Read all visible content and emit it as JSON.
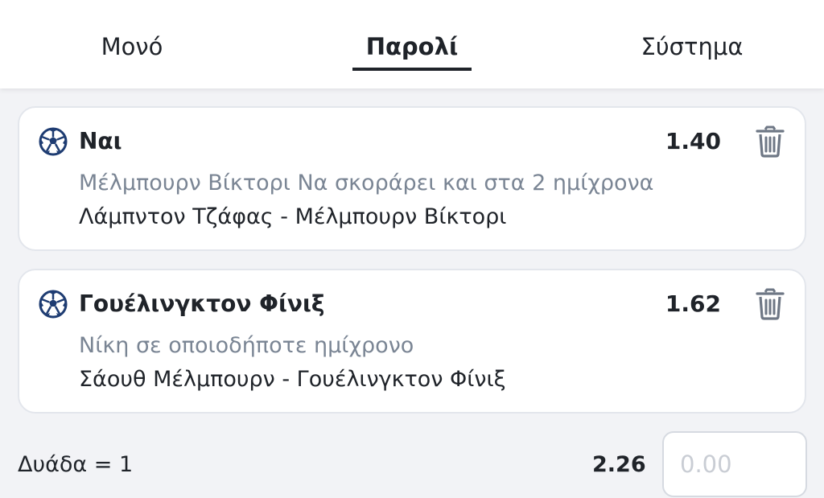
{
  "tabs": {
    "single": "Μονό",
    "parlay": "Παρολί",
    "system": "Σύστημα",
    "active": "parlay"
  },
  "selections": [
    {
      "title": "Ναι",
      "odds": "1.40",
      "market": "Μέλμπουρν Βίκτορι Να σκοράρει και στα 2 ημίχρονα",
      "event": "Λάμπντον Τζάφας - Μέλμπουρν Βίκτορι",
      "sport_icon": "soccer-ball-icon",
      "delete_icon": "trash-icon"
    },
    {
      "title": "Γουέλινγκτον Φίνιξ",
      "odds": "1.62",
      "market": "Νίκη σε οποιοδήποτε ημίχρονο",
      "event": "Σάουθ Μέλμπουρν - Γουέλινγκτον Φίνιξ",
      "sport_icon": "soccer-ball-icon",
      "delete_icon": "trash-icon"
    }
  ],
  "combo": {
    "label": "Δυάδα = 1",
    "odds": "2.26",
    "stake_placeholder": "0.00"
  },
  "colors": {
    "accent": "#1f2329",
    "muted_text": "#7a8594",
    "ball": "#1e3c72",
    "trash": "#6e7785"
  }
}
